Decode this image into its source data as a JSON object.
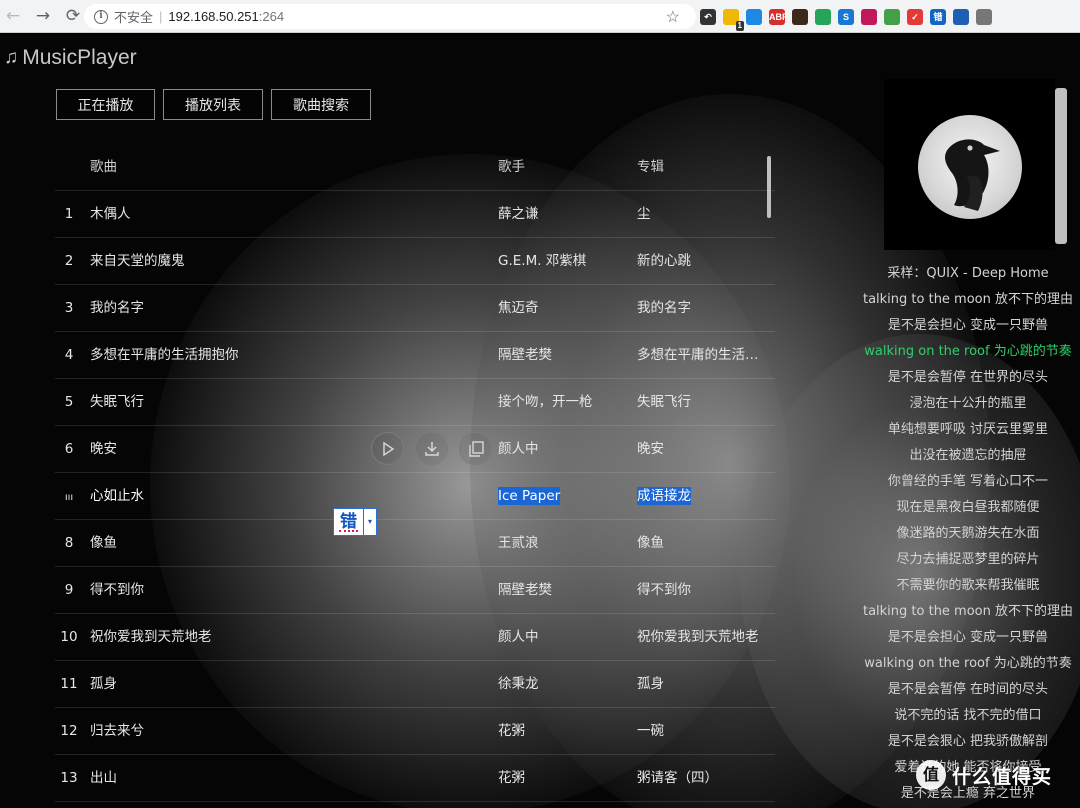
{
  "browser": {
    "back_glyph": "←",
    "forward_glyph": "→",
    "reload_glyph": "⟳",
    "info_glyph": "i",
    "security_label": "不安全",
    "separator": "|",
    "url_host": "192.168.50.251",
    "url_port": ":264",
    "star_glyph": "☆",
    "extensions": [
      {
        "name": "history-ext-icon",
        "label": "↶",
        "color": "#333333"
      },
      {
        "name": "notes-ext-icon",
        "label": "",
        "color": "#f2b705",
        "badge": "1"
      },
      {
        "name": "screenshot-ext-icon",
        "label": "",
        "color": "#1e88e5"
      },
      {
        "name": "adblock-plus-icon",
        "label": "ABP",
        "color": "#d32f2f"
      },
      {
        "name": "avatar-ext-icon",
        "label": "",
        "color": "#3b2a1a"
      },
      {
        "name": "translate-ext-icon",
        "label": "",
        "color": "#25a45a"
      },
      {
        "name": "s-ext-icon",
        "label": "S",
        "color": "#1976d2"
      },
      {
        "name": "chart-ext-icon",
        "label": "",
        "color": "#c2185b"
      },
      {
        "name": "color-ext-icon",
        "label": "",
        "color": "#43a047"
      },
      {
        "name": "check-ext-icon",
        "label": "✓",
        "color": "#e53935"
      },
      {
        "name": "spell-ext-icon",
        "label": "错",
        "color": "#1565c0"
      },
      {
        "name": "bookmark-ext-icon",
        "label": "",
        "color": "#1e5fb4"
      },
      {
        "name": "profile-ext-icon",
        "label": "",
        "color": "#777777"
      }
    ]
  },
  "app": {
    "title": "MusicPlayer",
    "note_glyph": "♫"
  },
  "tabs": [
    "正在播放",
    "播放列表",
    "歌曲搜索"
  ],
  "table": {
    "headers": {
      "name": "歌曲",
      "artist": "歌手",
      "album": "专辑"
    },
    "rows": [
      {
        "idx": "1",
        "name": "木偶人",
        "artist": "薛之谦",
        "album": "尘"
      },
      {
        "idx": "2",
        "name": "来自天堂的魔鬼",
        "artist": "G.E.M. 邓紫棋",
        "album": "新的心跳"
      },
      {
        "idx": "3",
        "name": "我的名字",
        "artist": "焦迈奇",
        "album": "我的名字"
      },
      {
        "idx": "4",
        "name": "多想在平庸的生活拥抱你",
        "artist": "隔壁老樊",
        "album": "多想在平庸的生活拥..."
      },
      {
        "idx": "5",
        "name": "失眠飞行",
        "artist": "接个吻，开一枪",
        "album": "失眠飞行"
      },
      {
        "idx": "6",
        "name": "晚安",
        "artist": "颜人中",
        "album": "晚安"
      },
      {
        "idx": "ııı",
        "name": "心如止水",
        "artist": "Ice Paper",
        "album": "成语接龙"
      },
      {
        "idx": "8",
        "name": "像鱼",
        "artist": "王贰浪",
        "album": "像鱼"
      },
      {
        "idx": "9",
        "name": "得不到你",
        "artist": "隔壁老樊",
        "album": "得不到你"
      },
      {
        "idx": "10",
        "name": "祝你爱我到天荒地老",
        "artist": "颜人中",
        "album": "祝你爱我到天荒地老"
      },
      {
        "idx": "11",
        "name": "孤身",
        "artist": "徐秉龙",
        "album": "孤身"
      },
      {
        "idx": "12",
        "name": "归去来兮",
        "artist": "花粥",
        "album": "一碗"
      },
      {
        "idx": "13",
        "name": "出山",
        "artist": "花粥",
        "album": "粥请客（四）"
      }
    ]
  },
  "spell_widget": {
    "label": "错",
    "arrow": "▾"
  },
  "lyrics": {
    "lines": [
      "采样：QUIX - Deep Home",
      "talking to the moon 放不下的理由",
      "是不是会担心 变成一只野兽",
      "walking on the roof 为心跳的节奏",
      "是不是会暂停 在世界的尽头",
      "浸泡在十公升的瓶里",
      "单纯想要呼吸 讨厌云里雾里",
      "出没在被遗忘的抽屉",
      "你曾经的手笔 写着心口不一",
      "现在是黑夜白昼我都随便",
      "像迷路的天鹅游失在水面",
      "尽力去捕捉恶梦里的碎片",
      "不需要你的歌来帮我催眠",
      "talking to the moon 放不下的理由",
      "是不是会担心 变成一只野兽",
      "walking on the roof 为心跳的节奏",
      "是不是会暂停 在时间的尽头",
      "说不完的话 找不完的借口",
      "是不是会狠心 把我骄傲解剖",
      "爱着谁的她 能否将你接受",
      "是不是会上瘾 弃之世界"
    ],
    "active_color": "#2fcf6a"
  },
  "watermark": {
    "logo": "值",
    "text": "什么值得买"
  }
}
